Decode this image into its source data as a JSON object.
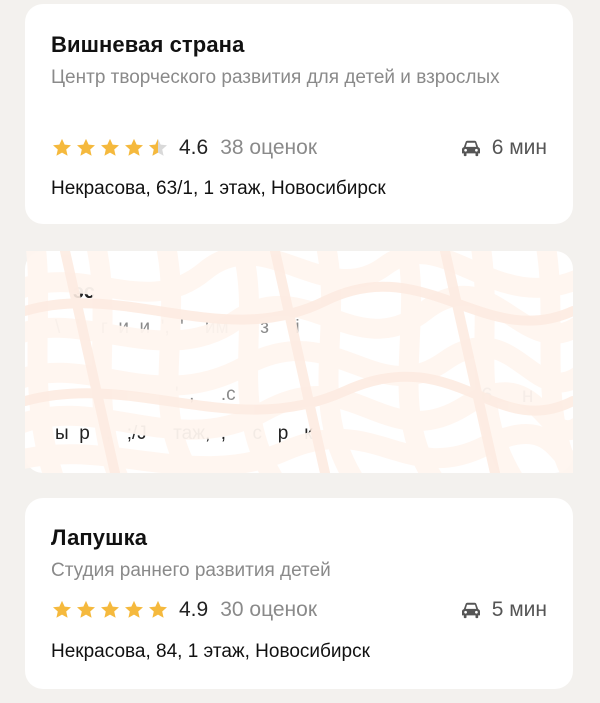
{
  "cards": [
    {
      "title": "Вишневая страна",
      "subtitle": "Центр творческого развития для детей и взрослых",
      "rating": "4.6",
      "rating_fraction": 0.92,
      "reviews": "38 оценок",
      "time": "6 мин",
      "address": "Некрасова, 63/1, 1 этаж, Новосибирск"
    },
    {
      "fragments": {
        "title": "эс",
        "subtitle": "\\   '    г  и  и  ',  '    им      з     i",
        "rating": "'  ,     .с",
        "time": "6     н",
        "address": "ы  р   ,   ;/J     таж,  ,     с   р   к"
      }
    },
    {
      "title": "Лапушка",
      "subtitle": "Студия раннего развития детей",
      "rating": "4.9",
      "rating_fraction": 0.98,
      "reviews": "30 оценок",
      "time": "5 мин",
      "address": "Некрасова, 84, 1 этаж, Новосибирск"
    }
  ],
  "icons": {
    "star": "star-icon",
    "car": "car-icon"
  },
  "colors": {
    "star": "#f5b93d",
    "star_empty": "#d9d9d9",
    "muted": "#8a8a8a",
    "card": "#ffffff",
    "background": "#f3f1ee"
  }
}
